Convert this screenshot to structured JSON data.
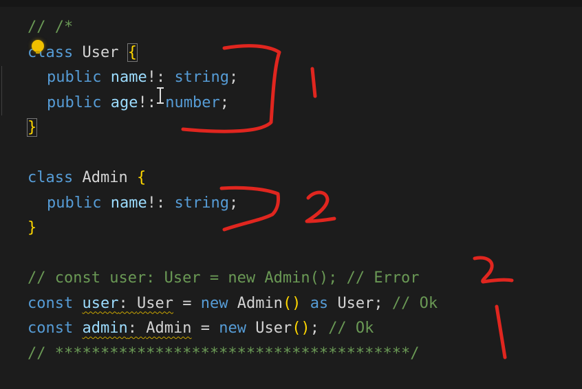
{
  "editor": {
    "lines": [
      {
        "tokens": [
          {
            "t": "// /*",
            "c": "cmt"
          }
        ]
      },
      {
        "tokens": [
          {
            "t": "class",
            "c": "kw"
          },
          {
            "t": " "
          },
          {
            "t": "User",
            "c": "cls"
          },
          {
            "t": " "
          },
          {
            "t": "{",
            "c": "brace",
            "box": true
          }
        ]
      },
      {
        "indent": true,
        "tokens": [
          {
            "t": "public",
            "c": "kw"
          },
          {
            "t": " "
          },
          {
            "t": "name",
            "c": "prop"
          },
          {
            "t": "!: ",
            "c": "punc"
          },
          {
            "t": "string",
            "c": "kw"
          },
          {
            "t": ";",
            "c": "punc"
          }
        ]
      },
      {
        "indent": true,
        "tokens": [
          {
            "t": "public",
            "c": "kw"
          },
          {
            "t": " "
          },
          {
            "t": "age",
            "c": "prop"
          },
          {
            "t": "!: ",
            "c": "punc"
          },
          {
            "t": "number",
            "c": "kw"
          },
          {
            "t": ";",
            "c": "punc"
          }
        ]
      },
      {
        "tokens": [
          {
            "t": "}",
            "c": "brace",
            "box": true
          }
        ]
      },
      {
        "tokens": []
      },
      {
        "tokens": [
          {
            "t": "class",
            "c": "kw"
          },
          {
            "t": " "
          },
          {
            "t": "Admin",
            "c": "cls"
          },
          {
            "t": " "
          },
          {
            "t": "{",
            "c": "brace"
          }
        ]
      },
      {
        "indent": true,
        "tokens": [
          {
            "t": "public",
            "c": "kw"
          },
          {
            "t": " "
          },
          {
            "t": "name",
            "c": "prop"
          },
          {
            "t": "!: ",
            "c": "punc"
          },
          {
            "t": "string",
            "c": "kw"
          },
          {
            "t": ";",
            "c": "punc"
          }
        ]
      },
      {
        "tokens": [
          {
            "t": "}",
            "c": "brace"
          }
        ]
      },
      {
        "tokens": []
      },
      {
        "tokens": [
          {
            "t": "// const user: User = new Admin(); // Error",
            "c": "cmt"
          }
        ]
      },
      {
        "tokens": [
          {
            "t": "const",
            "c": "kw"
          },
          {
            "t": " "
          },
          {
            "t": "user",
            "c": "ident",
            "squig": true
          },
          {
            "t": ": ",
            "c": "punc",
            "squig": true
          },
          {
            "t": "User",
            "c": "cls",
            "squig": true
          },
          {
            "t": " = ",
            "c": "punc"
          },
          {
            "t": "new",
            "c": "kw"
          },
          {
            "t": " "
          },
          {
            "t": "Admin",
            "c": "cls"
          },
          {
            "t": "()",
            "c": "brace"
          },
          {
            "t": " "
          },
          {
            "t": "as",
            "c": "kw"
          },
          {
            "t": " "
          },
          {
            "t": "User",
            "c": "cls"
          },
          {
            "t": "; ",
            "c": "punc"
          },
          {
            "t": "// Ok",
            "c": "cmt"
          }
        ]
      },
      {
        "tokens": [
          {
            "t": "const",
            "c": "kw"
          },
          {
            "t": " "
          },
          {
            "t": "admin",
            "c": "ident",
            "squig": true
          },
          {
            "t": ": ",
            "c": "punc",
            "squig": true
          },
          {
            "t": "Admin",
            "c": "cls",
            "squig": true
          },
          {
            "t": " = ",
            "c": "punc"
          },
          {
            "t": "new",
            "c": "kw"
          },
          {
            "t": " "
          },
          {
            "t": "User",
            "c": "cls"
          },
          {
            "t": "()",
            "c": "brace"
          },
          {
            "t": "; ",
            "c": "punc"
          },
          {
            "t": "// Ok",
            "c": "cmt"
          }
        ]
      },
      {
        "tokens": [
          {
            "t": "// ***************************************/",
            "c": "cmt"
          }
        ]
      }
    ]
  },
  "annotations": {
    "label_1": "1",
    "label_2": "2",
    "label_3": "2",
    "label_4": "1",
    "ink_color": "#e0261f"
  }
}
